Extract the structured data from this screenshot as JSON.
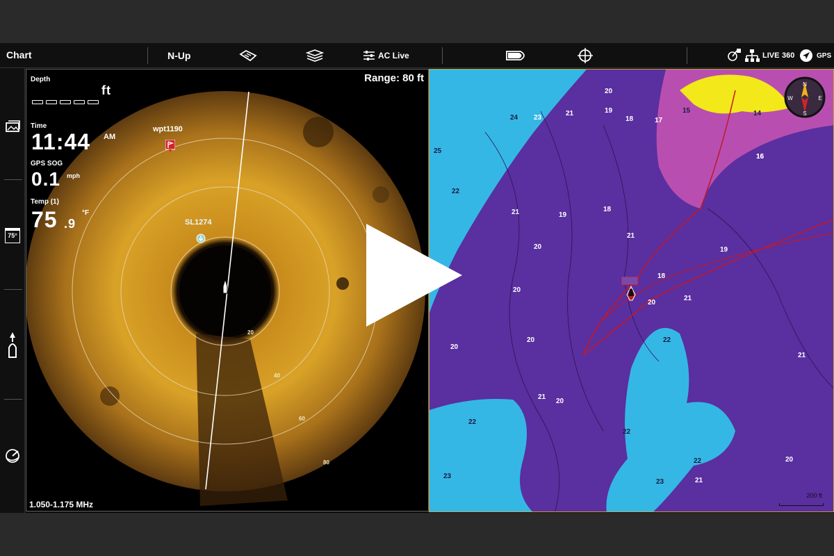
{
  "topbar": {
    "title": "Chart",
    "orientation": "N-Up",
    "ac_live": "AC Live",
    "live_label": "LIVE",
    "deg360_label": "360",
    "gps_label": "GPS"
  },
  "sidebar": {
    "temp_badge": "75°"
  },
  "sonar": {
    "range_label": "Range: 80 ft",
    "depth_label": "Depth",
    "depth_unit": "ft",
    "time_label": "Time",
    "time_value": "11:44",
    "time_ampm": "AM",
    "sog_label": "GPS SOG",
    "sog_value": "0.1",
    "sog_unit": "mph",
    "temp_label": "Temp (1)",
    "temp_value": "75",
    "temp_decimal": ".9",
    "temp_unit": "°F",
    "frequency": "1.050-1.175 MHz",
    "waypoint_1": "wpt1190",
    "waypoint_2": "SL1274",
    "ring_labels": [
      "20",
      "40",
      "60",
      "80"
    ]
  },
  "chart": {
    "scale_label": "200 ft",
    "compass": {
      "n": "N",
      "e": "E",
      "s": "S",
      "w": "W"
    },
    "depth_labels": [
      "25",
      "24",
      "23",
      "21",
      "20",
      "19",
      "18",
      "17",
      "16",
      "15",
      "14",
      "22",
      "21",
      "19",
      "18",
      "20",
      "21",
      "18",
      "19",
      "20",
      "20",
      "21",
      "20",
      "20",
      "21",
      "20",
      "22",
      "22",
      "22",
      "21",
      "23",
      "23",
      "22",
      "20",
      "21",
      "16"
    ]
  },
  "colors": {
    "deep_purple": "#5a2fa0",
    "shallow_cyan": "#35b7e6",
    "magenta": "#b84fb0",
    "yellow": "#f2e81a",
    "track_red": "#c0192a",
    "sonar_amber": "#c28a1e"
  }
}
